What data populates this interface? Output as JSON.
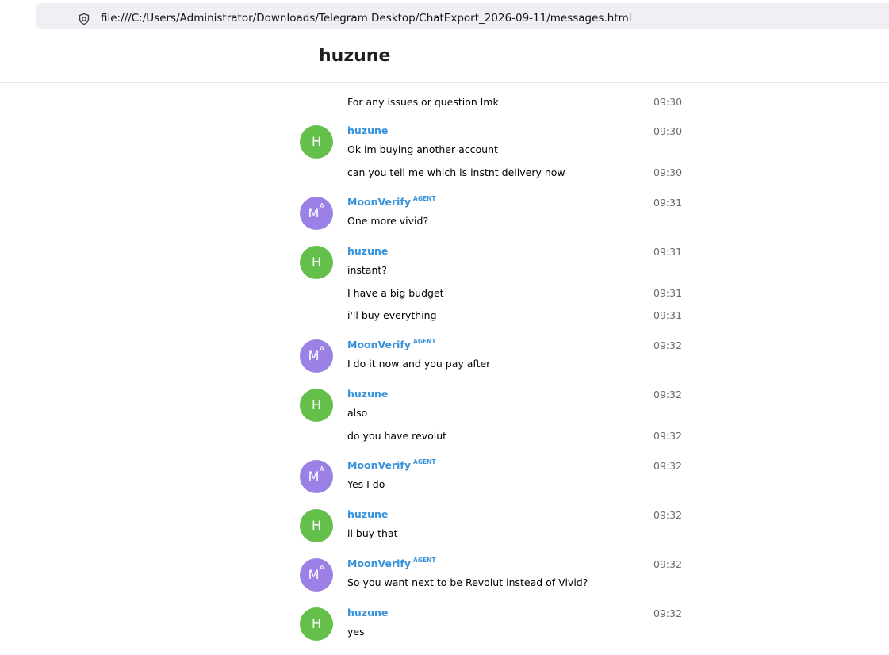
{
  "browser": {
    "url": "file:///C:/Users/Administrator/Downloads/Telegram Desktop/ChatExport_2026-09-11/messages.html"
  },
  "chat": {
    "title": "huzune"
  },
  "agent_badge": "AGENT",
  "avatars": {
    "huzune": "H",
    "moonverify": "M",
    "moonverify_sup": "A"
  },
  "history": {
    "partial_text": "For any issues or question lmk",
    "partial_time": "09:30",
    "groups": [
      {
        "sender": "huzune",
        "messages": [
          {
            "text": "Ok im buying another account",
            "time": "09:30"
          },
          {
            "text": "can you tell me which is instnt delivery now",
            "time": "09:30"
          }
        ]
      },
      {
        "sender": "MoonVerify",
        "messages": [
          {
            "text": "One more vivid?",
            "time": "09:31"
          }
        ]
      },
      {
        "sender": "huzune",
        "messages": [
          {
            "text": "instant?",
            "time": "09:31"
          },
          {
            "text": "I have a big budget",
            "time": "09:31"
          },
          {
            "text": "i'll buy everything",
            "time": "09:31"
          }
        ]
      },
      {
        "sender": "MoonVerify",
        "messages": [
          {
            "text": "I do it now and you pay after",
            "time": "09:32"
          }
        ]
      },
      {
        "sender": "huzune",
        "messages": [
          {
            "text": "also",
            "time": "09:32"
          },
          {
            "text": "do you have revolut",
            "time": "09:32"
          }
        ]
      },
      {
        "sender": "MoonVerify",
        "messages": [
          {
            "text": "Yes I do",
            "time": "09:32"
          }
        ]
      },
      {
        "sender": "huzune",
        "messages": [
          {
            "text": "il buy that",
            "time": "09:32"
          }
        ]
      },
      {
        "sender": "MoonVerify",
        "messages": [
          {
            "text": "So you want next to be Revolut instead of Vivid?",
            "time": "09:32"
          }
        ]
      },
      {
        "sender": "huzune",
        "messages": [
          {
            "text": "yes",
            "time": "09:32"
          }
        ]
      }
    ]
  }
}
